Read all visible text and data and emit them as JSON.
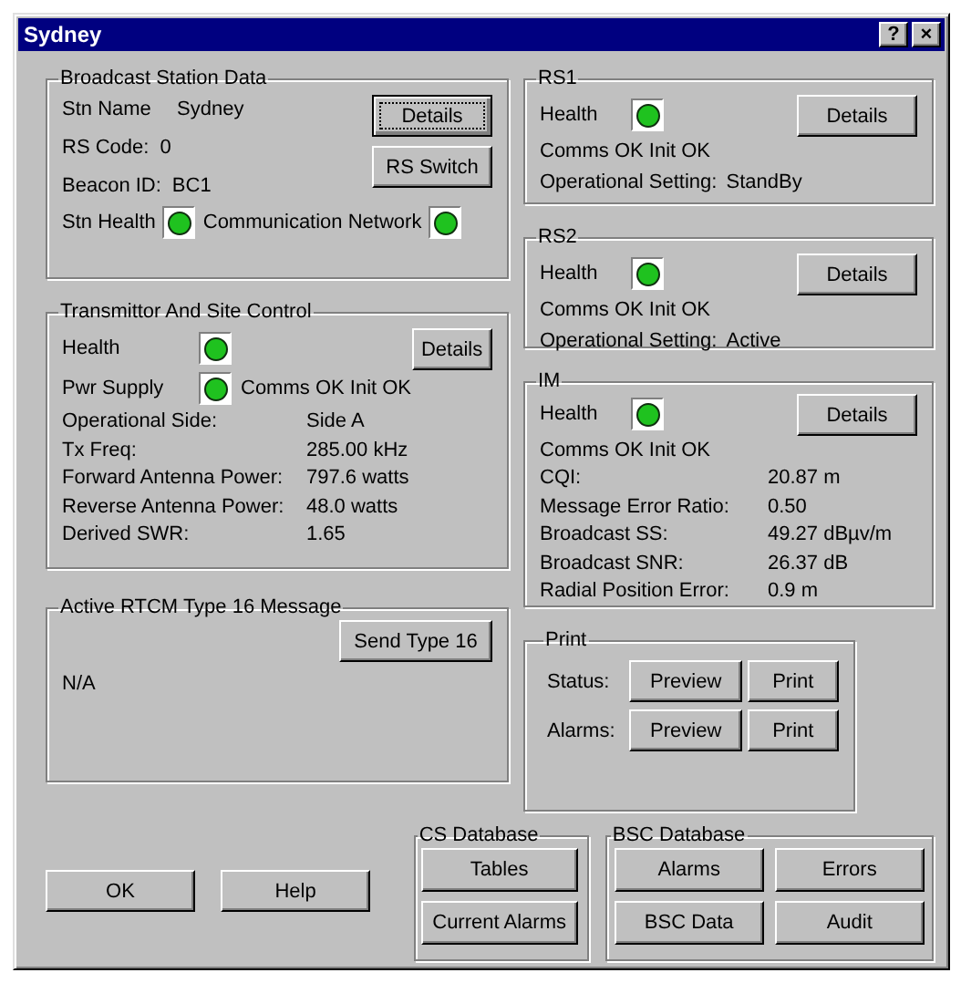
{
  "window": {
    "title": "Sydney",
    "buttons": [
      "?",
      "×"
    ]
  },
  "broadcast": {
    "title": "Broadcast Station Data",
    "fields": [
      {
        "label": "Stn Name",
        "value": "Sydney"
      },
      {
        "label": "RS Code:",
        "value": "0"
      },
      {
        "label": "Beacon ID:",
        "value": "BC1"
      }
    ],
    "details_button": {
      "label": "Details",
      "focused": true
    },
    "switch_button": "RS Switch",
    "health_label": "Stn Health",
    "health_lit": true,
    "network_label": "Communication Network",
    "network_lit": true
  },
  "transmitter": {
    "title": "Transmittor And Site Control",
    "details_button": "Details",
    "health_label": "Health",
    "health_lit": true,
    "power_label": "Pwr Supply",
    "power_lit": true,
    "power_text": "Comms OK Init OK",
    "fields": [
      {
        "label": "Operational Side:",
        "value": "Side A"
      },
      {
        "label": "Tx Freq:",
        "value": "285.00 kHz"
      },
      {
        "label": "Forward Antenna Power:",
        "value": "797.6 watts"
      },
      {
        "label": "Reverse Antenna Power:",
        "value": "48.0 watts"
      },
      {
        "label": "Derived SWR:",
        "value": "1.65"
      }
    ]
  },
  "rtcm": {
    "title": "Active RTCM Type 16 Message",
    "send_button": "Send Type 16",
    "message": "N/A"
  },
  "stations": [
    {
      "title": "RS1",
      "health_label": "Health",
      "health_lit": true,
      "details_button": "Details",
      "comms": "Comms OK Init OK",
      "setting_label": "Operational Setting:",
      "setting_value": "StandBy"
    },
    {
      "title": "RS2",
      "health_label": "Health",
      "health_lit": true,
      "details_button": "Details",
      "comms": "Comms OK Init OK",
      "setting_label": "Operational Setting:",
      "setting_value": "Active"
    }
  ],
  "im": {
    "title": "IM",
    "health_label": "Health",
    "health_lit": true,
    "details_button": "Details",
    "comms": "Comms OK Init OK",
    "fields": [
      {
        "label": "CQI:",
        "value": "20.87 m"
      },
      {
        "label": "Message Error Ratio:",
        "value": "0.50"
      },
      {
        "label": "Broadcast SS:",
        "value": "49.27 dBµv/m"
      },
      {
        "label": "Broadcast SNR:",
        "value": "26.37 dB"
      },
      {
        "label": "Radial Position Error:",
        "value": "0.9 m"
      }
    ]
  },
  "print": {
    "title": "Print",
    "rows": [
      {
        "label": "Status:",
        "buttons": [
          "Preview",
          "Print"
        ]
      },
      {
        "label": "Alarms:",
        "buttons": [
          "Preview",
          "Print"
        ]
      }
    ]
  },
  "footer_buttons": [
    "OK",
    "Help"
  ],
  "cs_database": {
    "title": "CS Database",
    "buttons": [
      "Tables",
      "Current Alarms"
    ]
  },
  "bsc_database": {
    "title": "BSC Database",
    "buttons": [
      "Alarms",
      "Errors",
      "BSC Data",
      "Audit"
    ]
  }
}
